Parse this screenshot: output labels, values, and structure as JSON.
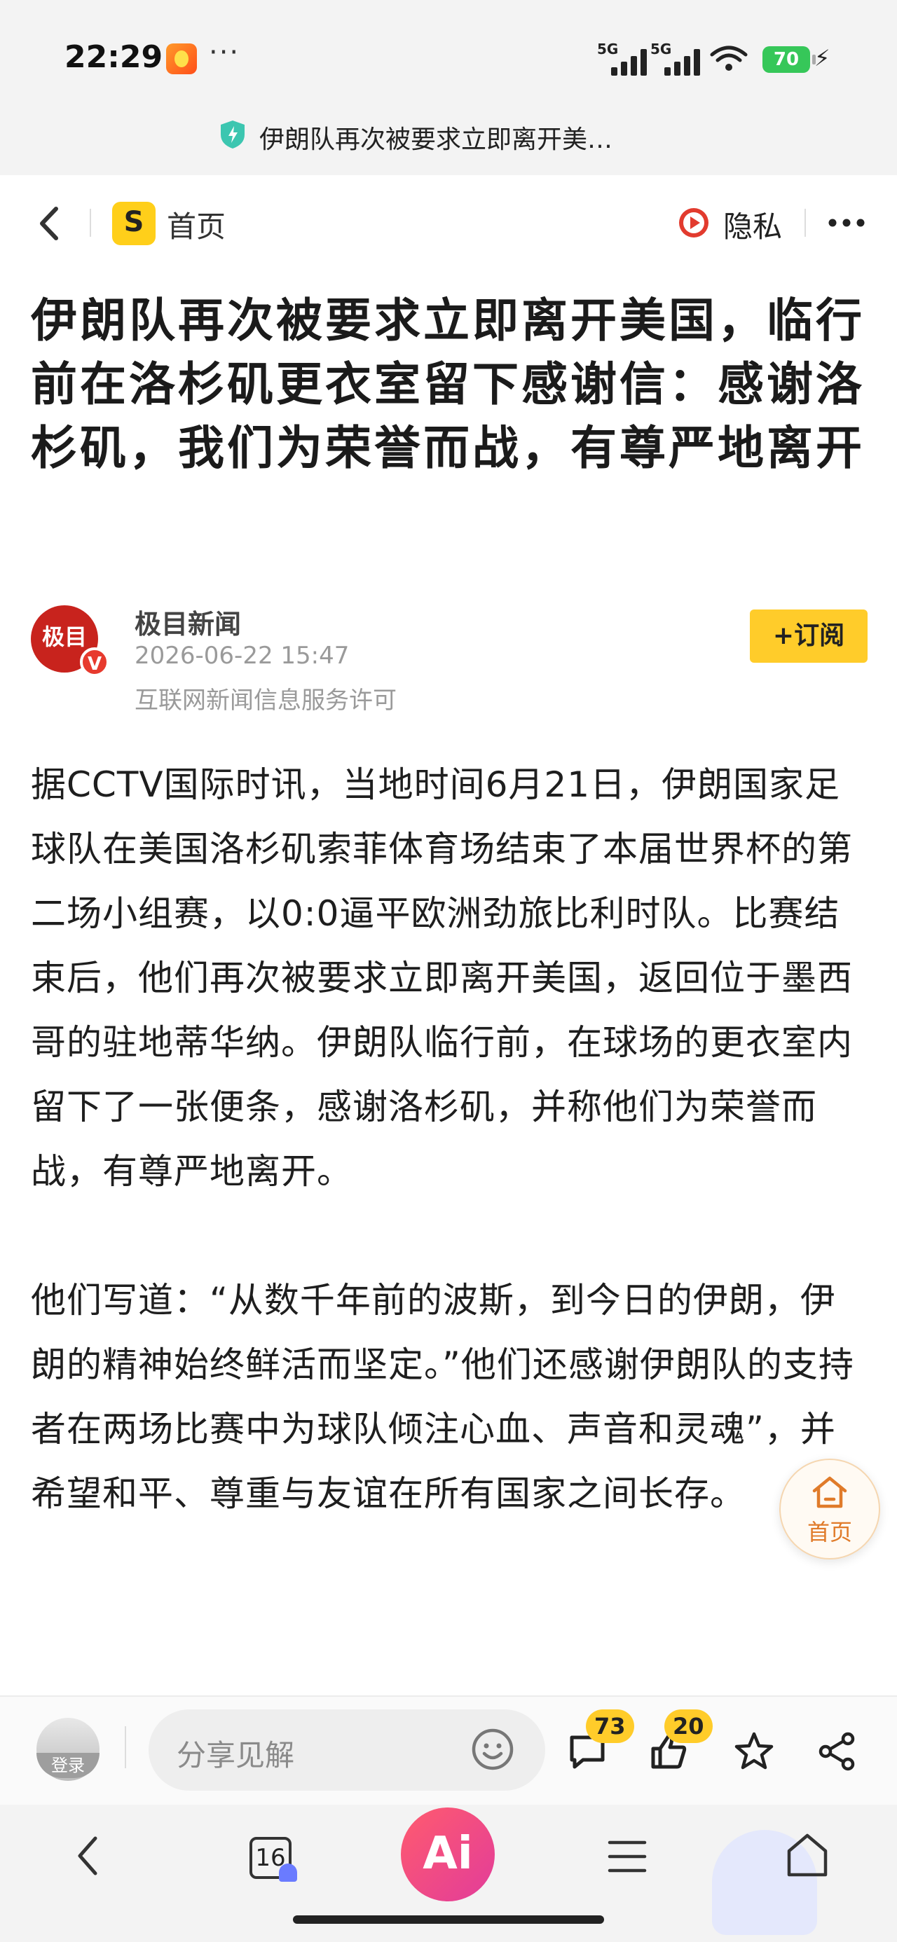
{
  "status_bar": {
    "time": "22:29",
    "dots": "···",
    "network_1": "5G",
    "network_2": "5G",
    "battery": "70"
  },
  "browser": {
    "page_title": "伊朗队再次被要求立即离开美…",
    "tabs_count": "16",
    "ai_label": "Ai"
  },
  "nav": {
    "logo_letter": "S",
    "home_label": "首页",
    "privacy_label": "隐私"
  },
  "article": {
    "title": "伊朗队再次被要求立即离开美国，临行前在洛杉矶更衣室留下感谢信：感谢洛杉矶，我们为荣誉而战，有尊严地离开",
    "source": {
      "avatar_text": "极目",
      "verified_mark": "V",
      "name": "极目新闻",
      "date": "2026-06-22 15:47",
      "license": "互联网新闻信息服务许可"
    },
    "subscribe_label": "+订阅",
    "paragraphs": [
      "据CCTV国际时讯，当地时间6月21日，伊朗国家足球队在美国洛杉矶索菲体育场结束了本届世界杯的第二场小组赛，以0:0逼平欧洲劲旅比利时队。比赛结束后，他们再次被要求立即离开美国，返回位于墨西哥的驻地蒂华纳。伊朗队临行前，在球场的更衣室内留下了一张便条，感谢洛杉矶，并称他们为荣誉而战，有尊严地离开。",
      "他们写道：“从数千年前的波斯，到今日的伊朗，伊朗的精神始终鲜活而坚定。”他们还感谢伊朗队的支持者在两场比赛中为球队倾注心血、声音和灵魂”，并希望和平、尊重与友谊在所有国家之间长存。"
    ]
  },
  "float_home_label": "首页",
  "comment_bar": {
    "login_label": "登录",
    "placeholder": "分享见解",
    "comments_count": "73",
    "likes_count": "20"
  }
}
